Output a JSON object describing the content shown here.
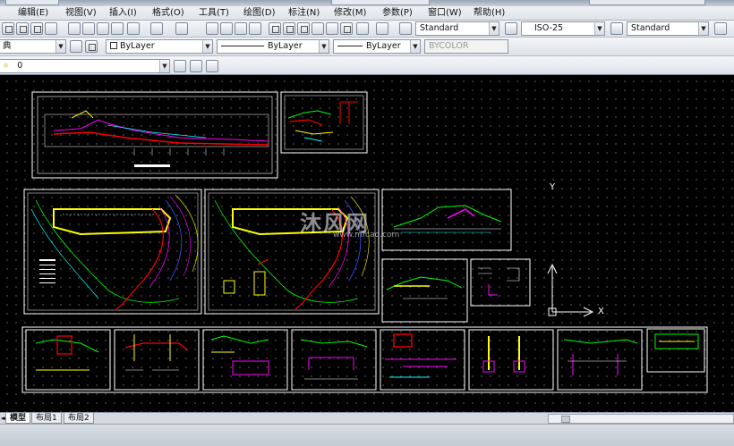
{
  "menu": {
    "items": [
      "编辑(E)",
      "视图(V)",
      "插入(I)",
      "格式(O)",
      "工具(T)",
      "绘图(D)",
      "标注(N)",
      "修改(M)",
      "参数(P)",
      "窗口(W)",
      "帮助(H)"
    ]
  },
  "toolbar_styles": {
    "text_style": "Standard",
    "dim_style": "ISO-25",
    "table_style": "Standard"
  },
  "toolbar_properties": {
    "workspace_fragment": "典",
    "color": "ByLayer",
    "linetype": "ByLayer",
    "lineweight": "ByLayer",
    "plotstyle": "BYCOLOR"
  },
  "toolbar_layers": {
    "current_layer": "0"
  },
  "canvas": {
    "watermark_text": "沐风网",
    "watermark_url": "www.mfcad.com",
    "ucs_x": "X",
    "ucs_y": "Y"
  },
  "layout_tabs": [
    "模型",
    "布局1",
    "布局2"
  ],
  "colors": {
    "canvas": "#000000",
    "cad_yellow": "#ffff00",
    "cad_red": "#ff0000",
    "cad_magenta": "#ff00ff",
    "cad_cyan": "#00ffff",
    "cad_green": "#00ff00",
    "cad_blue": "#3c50ff"
  }
}
